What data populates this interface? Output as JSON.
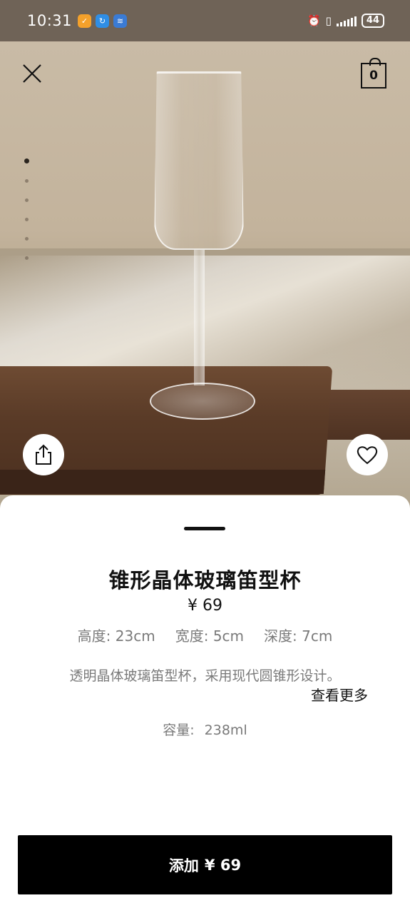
{
  "status_bar": {
    "time": "10:31",
    "battery": "44"
  },
  "header": {
    "cart_count": "0"
  },
  "carousel": {
    "image_count": 6,
    "active_index": 0
  },
  "product": {
    "title": "锥形晶体玻璃笛型杯",
    "price": "¥ 69",
    "dimensions": [
      {
        "label": "高度",
        "value": "23cm"
      },
      {
        "label": "宽度",
        "value": "5cm"
      },
      {
        "label": "深度",
        "value": "7cm"
      }
    ],
    "description": "透明晶体玻璃笛型杯，采用现代圆锥形设计。",
    "more_label": "查看更多",
    "capacity_label": "容量:",
    "capacity_value": "238ml"
  },
  "cta": {
    "add_label": "添加",
    "add_price": "¥ 69"
  },
  "colors": {
    "button_bg": "#000000",
    "secondary_text": "#7a7a7a"
  }
}
